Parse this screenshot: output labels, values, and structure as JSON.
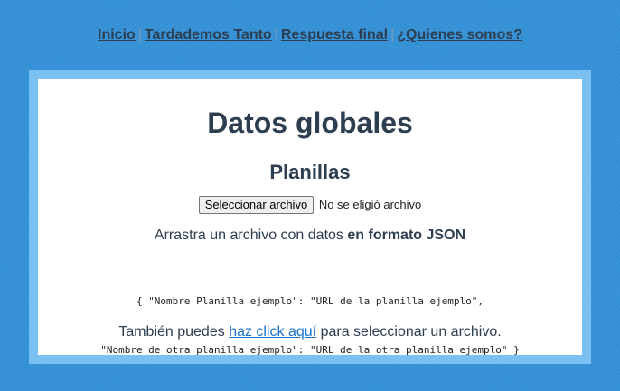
{
  "nav": {
    "items": [
      {
        "label": "Inicio"
      },
      {
        "label": "Tardademos Tanto"
      },
      {
        "label": "Respuesta final"
      },
      {
        "label": "¿Quienes somos?"
      }
    ],
    "separator": "|"
  },
  "main": {
    "title": "Datos globales",
    "subtitle": "Planillas",
    "file_input": {
      "button_label": "Seleccionar archivo",
      "status": "No se eligió archivo"
    },
    "drag_text": "Arrastra un archivo con datos",
    "drag_text_bold": "en formato JSON",
    "example_line_1": "{ \"Nombre Planilla ejemplo\": \"URL de la planilla ejemplo\",",
    "example_line_2": "\"Nombre de otra planilla ejemplo\": \"URL de la otra planilla ejemplo\" }",
    "click_prefix": "También puedes",
    "click_link": "haz click aquí",
    "click_suffix": "para seleccionar un archivo."
  },
  "colors": {
    "background": "#3592d8",
    "frame": "#7ac0f2",
    "panel": "#ffffff",
    "text": "#2c3e50",
    "link": "#1a73c9"
  }
}
